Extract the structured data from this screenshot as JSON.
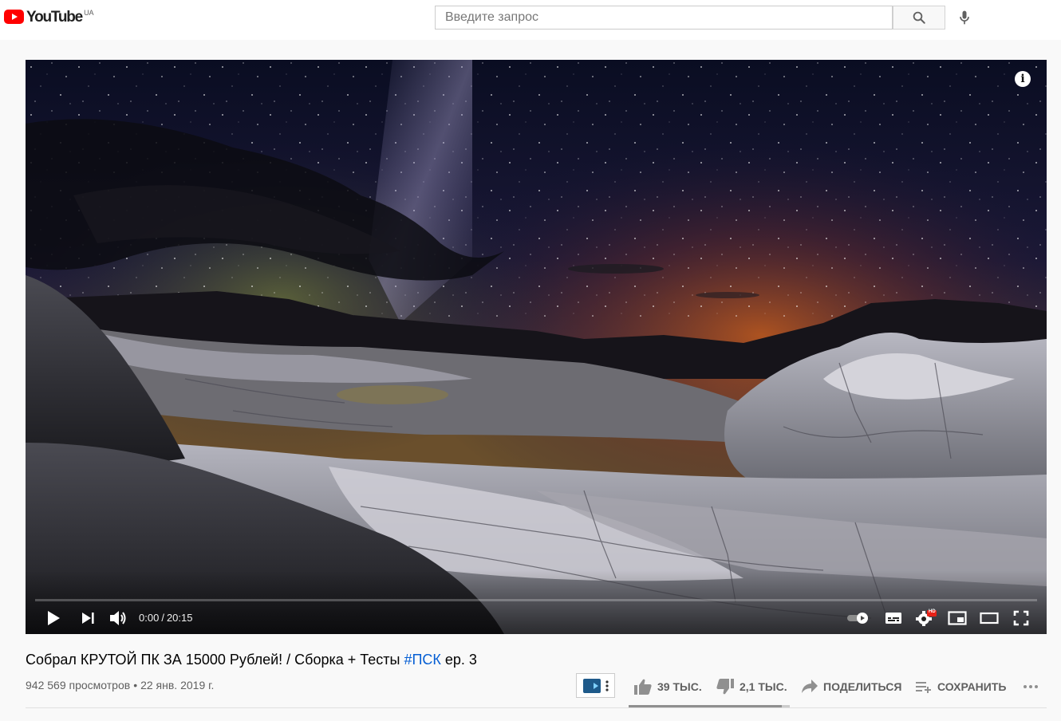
{
  "header": {
    "logo_text": "YouTube",
    "country_code": "UA",
    "search_placeholder": "Введите запрос",
    "search_icon": "search-icon",
    "mic_icon": "mic-icon",
    "brand_color": "#ff0000"
  },
  "player": {
    "info_label": "i",
    "current_time": "0:00",
    "separator": "/",
    "duration": "20:15",
    "progress": 0,
    "controls": [
      "play-icon",
      "next-icon",
      "volume-icon",
      "autoplay-toggle-icon",
      "subtitles-icon",
      "settings-icon",
      "miniplayer-icon",
      "theater-mode-icon",
      "fullscreen-icon"
    ],
    "hd_badge": "HD"
  },
  "video": {
    "title_main": "Собрал КРУТОЙ ПК ЗА 15000 Рублей! / Сборка + Тесты",
    "title_hashtag": "#ПСК",
    "title_tail": "ep. 3",
    "views": "942 569 просмотров",
    "meta_separator": "•",
    "date": "22 янв. 2019 г.",
    "hashtag_color": "#065fd4"
  },
  "actions": {
    "likes": "39 ТЫС.",
    "dislikes": "2,1 ТЫС.",
    "share": "ПОДЕЛИТЬСЯ",
    "save": "СОХРАНИТЬ",
    "like_ratio": 0.949
  }
}
